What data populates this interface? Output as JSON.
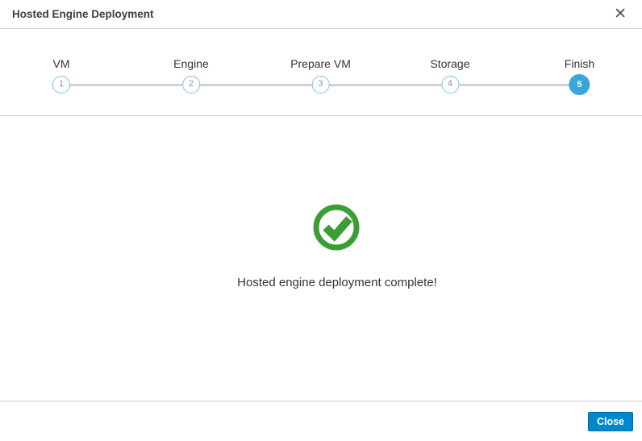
{
  "dialog": {
    "title": "Hosted Engine Deployment",
    "close_icon": "close-x-icon"
  },
  "wizard": {
    "steps": [
      {
        "label": "VM",
        "number": "1",
        "active": false
      },
      {
        "label": "Engine",
        "number": "2",
        "active": false
      },
      {
        "label": "Prepare VM",
        "number": "3",
        "active": false
      },
      {
        "label": "Storage",
        "number": "4",
        "active": false
      },
      {
        "label": "Finish",
        "number": "5",
        "active": true
      }
    ],
    "active_step": 5
  },
  "content": {
    "status_icon": "success-check-circle-icon",
    "message": "Hosted engine deployment complete!"
  },
  "footer": {
    "close_label": "Close"
  },
  "colors": {
    "primary_button": "#0088ce",
    "active_step_fill": "#39a5dc",
    "inactive_step_border": "#7dc3e8",
    "success_green": "#3a9e35",
    "divider": "#d1d1d1"
  }
}
